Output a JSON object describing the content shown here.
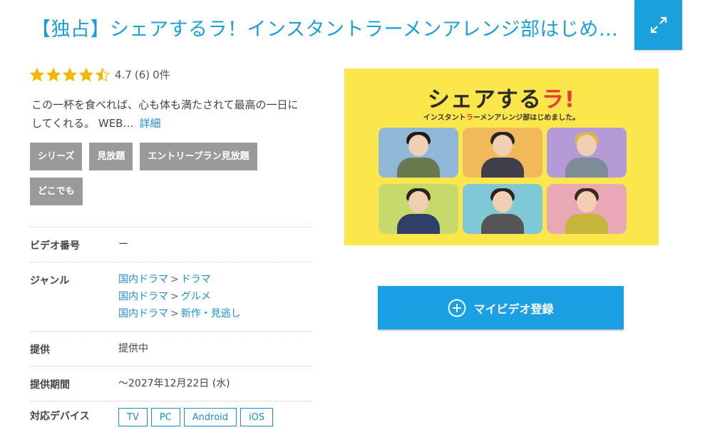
{
  "title": "【独占】シェアするラ！インスタントラーメンアレンジ部はじめ…",
  "rating": {
    "stars": 4.5,
    "score": "4.7",
    "count": "(6)",
    "reviews": "0件"
  },
  "description": {
    "line1": "この一杯を食べれば、心も体も満たされて最高の一日に",
    "line2": "してくれる。 WEB…",
    "more_label": "詳細"
  },
  "tags": [
    "シリーズ",
    "見放題",
    "エントリープラン見放題",
    "どこでも"
  ],
  "meta": {
    "video_number": {
      "label": "ビデオ番号",
      "value": "ー"
    },
    "genre": {
      "label": "ジャンル",
      "items": [
        {
          "parent": "国内ドラマ",
          "sep": ">",
          "child": "ドラマ"
        },
        {
          "parent": "国内ドラマ",
          "sep": ">",
          "child": "グルメ"
        },
        {
          "parent": "国内ドラマ",
          "sep": ">",
          "child": "新作・見逃し"
        }
      ]
    },
    "provide": {
      "label": "提供",
      "value": "提供中"
    },
    "period": {
      "label": "提供期間",
      "value": "～2027年12月22日 (水)"
    },
    "devices": {
      "label": "対応デバイス",
      "items": [
        "TV",
        "PC",
        "Android",
        "iOS"
      ]
    }
  },
  "thumbnail": {
    "logo_prefix": "シェアする",
    "logo_accent": "ラ!",
    "subtitle_prefix": "インスタント",
    "subtitle_accent": "ラ",
    "subtitle_suffix": "ーメンアレンジ部はじめました。"
  },
  "register_button": {
    "label": "マイビデオ登録"
  },
  "colors": {
    "accent": "#1aa0dc",
    "tag_bg": "#9a9a9a",
    "thumb_bg": "#fbe74b",
    "logo_red": "#e8393f"
  },
  "icons": {
    "expand": "expand-icon",
    "star": "star-icon",
    "plus": "plus-circle-icon"
  }
}
